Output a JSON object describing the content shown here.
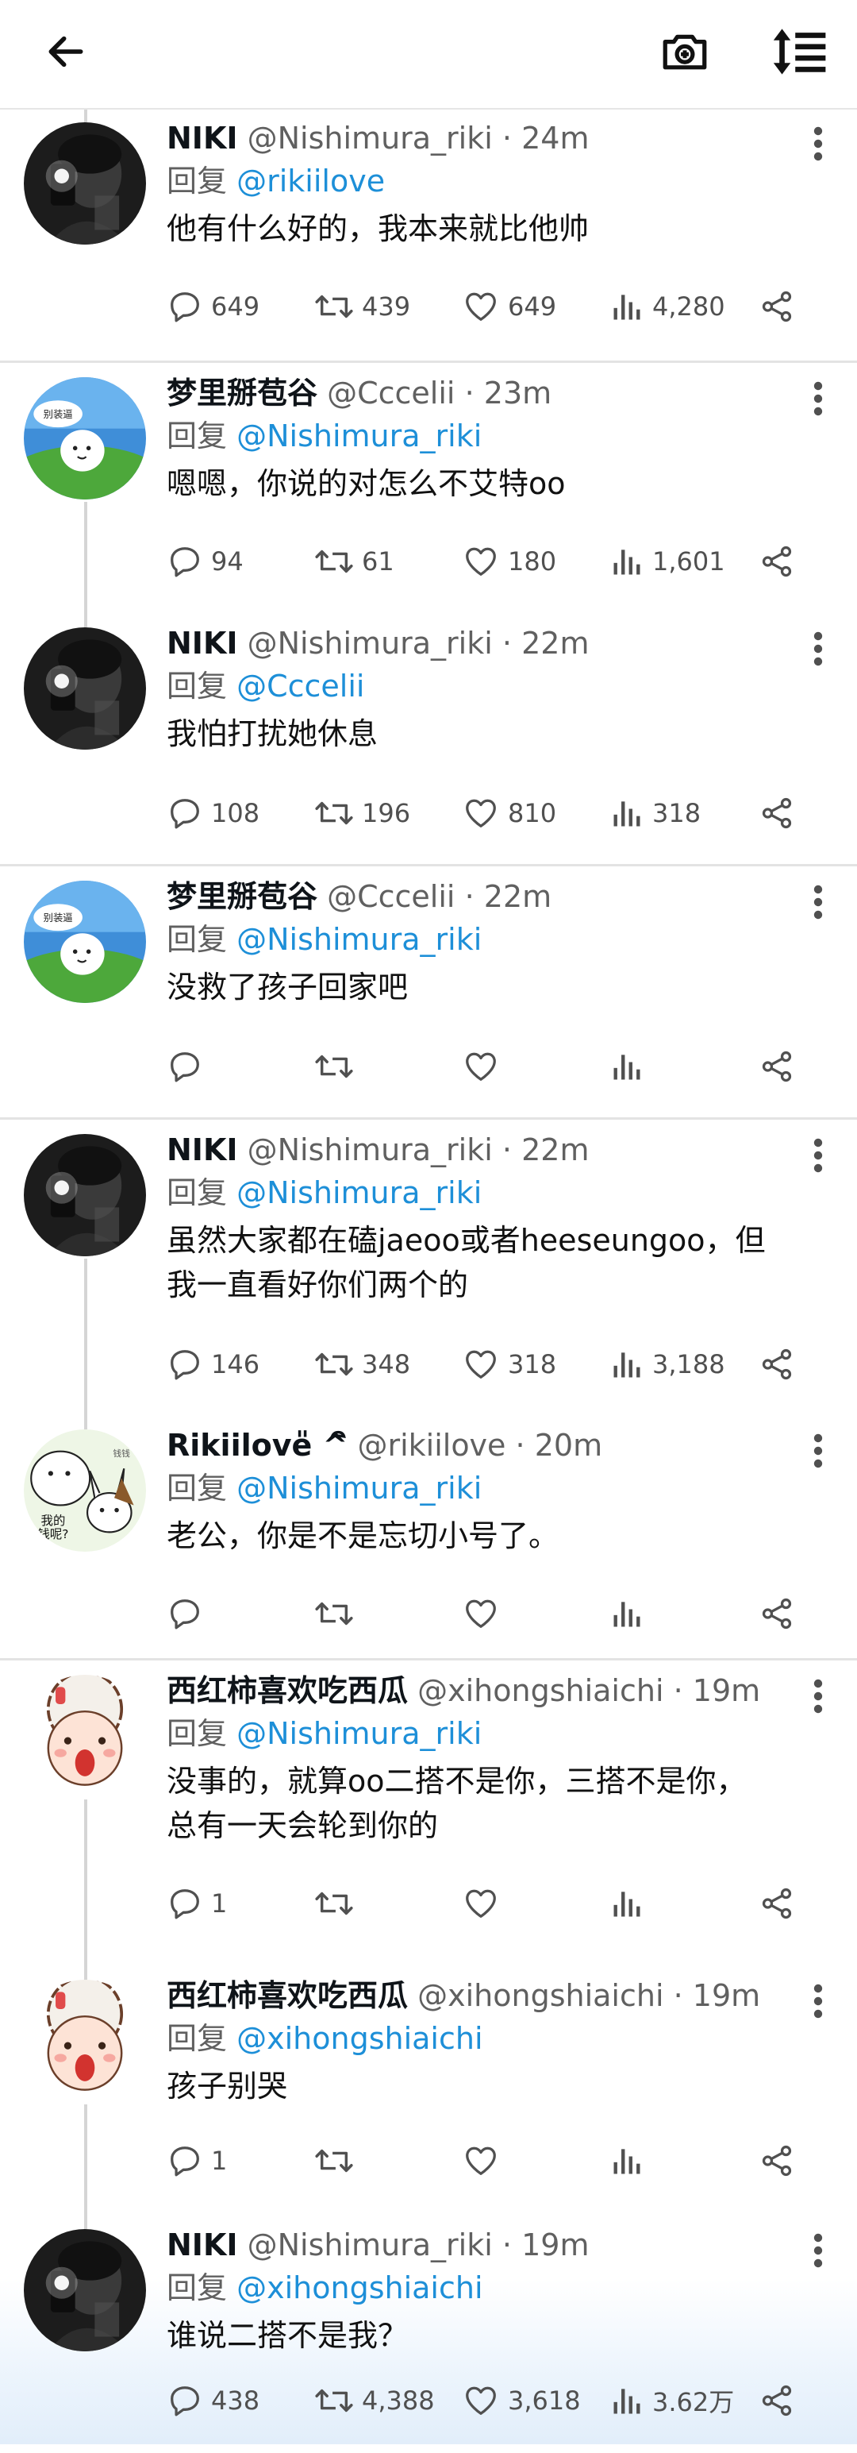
{
  "colors": {
    "link": "#1d8fd8",
    "muted": "#606060",
    "divider": "#e3e3e3",
    "thread": "#d5d5d5"
  },
  "topbar": {
    "back_icon": "arrow-left-icon",
    "camera_icon": "add-photo-icon",
    "sort_icon": "sort-icon"
  },
  "reply_prefix": "回复",
  "tweets": [
    {
      "name": "NIKI",
      "handle": "@Nishimura_riki",
      "time": "24m",
      "reply_to": "@rikiilove",
      "text": "他有什么好的，我本来就比他帅",
      "stats": {
        "replies": "649",
        "retweets": "439",
        "likes": "649",
        "views": "4,280"
      },
      "avatar": "niki"
    },
    {
      "name": "梦里掰苞谷",
      "handle": "@Cccelii",
      "time": "23m",
      "reply_to": "@Nishimura_riki",
      "text": "嗯嗯，你说的对怎么不艾特oo",
      "stats": {
        "replies": "94",
        "retweets": "61",
        "likes": "180",
        "views": "1,601"
      },
      "avatar": "ghost",
      "avatar_text": "别装逼"
    },
    {
      "name": "NIKI",
      "handle": "@Nishimura_riki",
      "time": "22m",
      "reply_to": "@Cccelii",
      "text": "我怕打扰她休息",
      "stats": {
        "replies": "108",
        "retweets": "196",
        "likes": "810",
        "views": "318"
      },
      "avatar": "niki"
    },
    {
      "name": "梦里掰苞谷",
      "handle": "@Cccelii",
      "time": "22m",
      "reply_to": "@Nishimura_riki",
      "text": "没救了孩子回家吧",
      "stats": {
        "replies": "",
        "retweets": "",
        "likes": "",
        "views": ""
      },
      "avatar": "ghost",
      "avatar_text": "别装逼"
    },
    {
      "name": "NIKI",
      "handle": "@Nishimura_riki",
      "time": "22m",
      "reply_to": "@Nishimura_riki",
      "text": "虽然大家都在磕jaeoo或者heeseungoo，但\n我一直看好你们两个的",
      "stats": {
        "replies": "146",
        "retweets": "348",
        "likes": "318",
        "views": "3,188"
      },
      "avatar": "niki"
    },
    {
      "name": "Rikiilove̎ ^ิ",
      "handle": "@rikiilove",
      "time": "20m",
      "reply_to": "@Nishimura_riki",
      "text": "老公，你是不是忘切小号了。",
      "stats": {
        "replies": "",
        "retweets": "",
        "likes": "",
        "views": ""
      },
      "avatar": "bunny",
      "avatar_text": "我的\n钱呢?",
      "avatar_text2": "钱钱"
    },
    {
      "name": "西红柿喜欢吃西瓜",
      "handle": "@xihongshiaichi",
      "time": "19m",
      "reply_to": "@Nishimura_riki",
      "text": "没事的，就算oo二搭不是你，三搭不是你，\n总有一天会轮到你的",
      "stats": {
        "replies": "1",
        "retweets": "",
        "likes": "",
        "views": ""
      },
      "avatar": "sheep"
    },
    {
      "name": "西红柿喜欢吃西瓜",
      "handle": "@xihongshiaichi",
      "time": "19m",
      "reply_to": "@xihongshiaichi",
      "text": "孩子别哭",
      "stats": {
        "replies": "1",
        "retweets": "",
        "likes": "",
        "views": ""
      },
      "avatar": "sheep"
    },
    {
      "name": "NIKI",
      "handle": "@Nishimura_riki",
      "time": "19m",
      "reply_to": "@xihongshiaichi",
      "text": "谁说二搭不是我？",
      "stats": {
        "replies": "438",
        "retweets": "4,388",
        "likes": "3,618",
        "views": "3.62万"
      },
      "avatar": "niki"
    }
  ]
}
